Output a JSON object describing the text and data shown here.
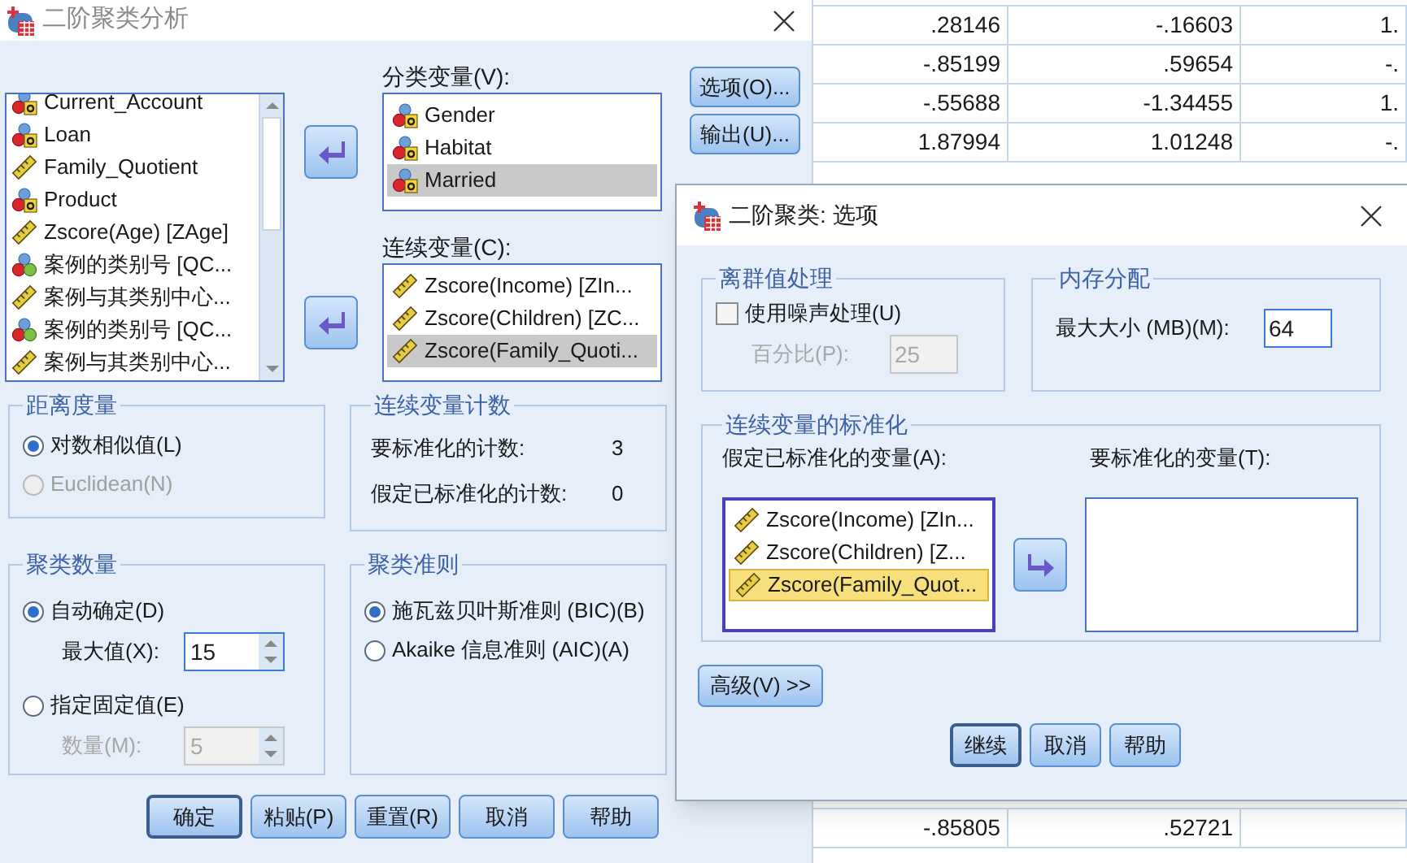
{
  "spreadsheet": {
    "rows": [
      {
        "cells": [
          ".28146",
          "-.16603",
          "1."
        ]
      },
      {
        "cells": [
          "-.85199",
          ".59654",
          "-."
        ]
      },
      {
        "cells": [
          "-.55688",
          "-1.34455",
          "1."
        ]
      },
      {
        "cells": [
          "1.87994",
          "1.01248",
          "-."
        ]
      }
    ],
    "bottom_rows": [
      {
        "cells": [
          "-.85805",
          ".52721",
          ""
        ]
      }
    ]
  },
  "main_dialog": {
    "title": "二阶聚类分析",
    "source_list": {
      "items": [
        {
          "label": "Current_Account",
          "kind": "nominal"
        },
        {
          "label": "Loan",
          "kind": "nominal"
        },
        {
          "label": "Family_Quotient",
          "kind": "scale"
        },
        {
          "label": "Product",
          "kind": "nominal"
        },
        {
          "label": "Zscore(Age) [ZAge]",
          "kind": "scale"
        },
        {
          "label": "案例的类别号 [QC...",
          "kind": "cluster"
        },
        {
          "label": "案例与其类别中心...",
          "kind": "scale"
        },
        {
          "label": "案例的类别号 [QC...",
          "kind": "cluster"
        },
        {
          "label": "案例与其类别中心...",
          "kind": "scale"
        }
      ]
    },
    "categorical": {
      "label": "分类变量(V):",
      "items": [
        {
          "label": "Gender",
          "kind": "nominal",
          "selected": false
        },
        {
          "label": "Habitat",
          "kind": "nominal",
          "selected": false
        },
        {
          "label": "Married",
          "kind": "nominal",
          "selected": true
        }
      ]
    },
    "continuous": {
      "label": "连续变量(C):",
      "items": [
        {
          "label": "Zscore(Income) [ZIn...",
          "kind": "scale",
          "selected": false
        },
        {
          "label": "Zscore(Children) [ZC...",
          "kind": "scale",
          "selected": false
        },
        {
          "label": "Zscore(Family_Quoti...",
          "kind": "scale",
          "selected": true
        }
      ]
    },
    "side_buttons": [
      "选项(O)...",
      "输出(U)..."
    ],
    "distance": {
      "title": "距离度量",
      "options": [
        {
          "label": "对数相似值(L)",
          "selected": true,
          "disabled": false
        },
        {
          "label": "Euclidean(N)",
          "selected": false,
          "disabled": true
        }
      ]
    },
    "counts": {
      "title": "连续变量计数",
      "rows": [
        {
          "label": "要标准化的计数:",
          "value": "3"
        },
        {
          "label": "假定已标准化的计数:",
          "value": "0"
        }
      ]
    },
    "num_clusters": {
      "title": "聚类数量",
      "options": [
        {
          "label": "自动确定(D)",
          "selected": true,
          "field_label": "最大值(X):",
          "field_value": "15",
          "disabled": false
        },
        {
          "label": "指定固定值(E)",
          "selected": false,
          "field_label": "数量(M):",
          "field_value": "5",
          "disabled": true
        }
      ]
    },
    "criterion": {
      "title": "聚类准则",
      "options": [
        {
          "label": "施瓦兹贝叶斯准则 (BIC)(B)",
          "selected": true,
          "disabled": false
        },
        {
          "label": "Akaike 信息准则 (AIC)(A)",
          "selected": false,
          "disabled": false
        }
      ]
    },
    "buttons": [
      {
        "label": "确定",
        "default": true
      },
      {
        "label": "粘贴(P)",
        "default": false
      },
      {
        "label": "重置(R)",
        "default": false
      },
      {
        "label": "取消",
        "default": false
      },
      {
        "label": "帮助",
        "default": false
      }
    ]
  },
  "options_dialog": {
    "title": "二阶聚类: 选项",
    "outliers": {
      "title": "离群值处理",
      "checkbox_label": "使用噪声处理(U)",
      "checked": false,
      "percent_label": "百分比(P):",
      "percent_value": "25",
      "percent_disabled": true
    },
    "memory": {
      "title": "内存分配",
      "label": "最大大小 (MB)(M):",
      "value": "64"
    },
    "standardization": {
      "title": "连续变量的标准化",
      "left_label": "假定已标准化的变量(A):",
      "right_label": "要标准化的变量(T):",
      "items": [
        {
          "label": "Zscore(Income) [ZIn...",
          "kind": "scale",
          "selected": false
        },
        {
          "label": "Zscore(Children) [Z...",
          "kind": "scale",
          "selected": false
        },
        {
          "label": "Zscore(Family_Quot...",
          "kind": "scale",
          "selected": true
        }
      ]
    },
    "advanced_button": "高级(V) >>",
    "buttons": [
      {
        "label": "继续",
        "default": true
      },
      {
        "label": "取消",
        "default": false
      },
      {
        "label": "帮助",
        "default": false
      }
    ]
  }
}
